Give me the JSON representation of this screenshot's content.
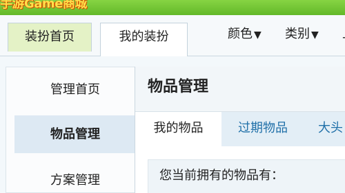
{
  "banner": {
    "title": "手游Game商城"
  },
  "tabs": [
    {
      "label": "装扮首页"
    },
    {
      "label": "我的装扮"
    }
  ],
  "filters": [
    {
      "label": "颜色",
      "icon": "caret-down-icon"
    },
    {
      "label": "类别",
      "icon": "caret-down-icon"
    },
    {
      "label": "上"
    }
  ],
  "sidebar": {
    "items": [
      {
        "label": "管理首页"
      },
      {
        "label": "物品管理"
      },
      {
        "label": "方案管理"
      }
    ]
  },
  "main": {
    "title": "物品管理",
    "subtabs": [
      {
        "label": "我的物品"
      },
      {
        "label": "过期物品"
      },
      {
        "label": "大头"
      }
    ],
    "content_text": "您当前拥有的物品有："
  },
  "colors": {
    "banner_green": "#74c636",
    "active_tab": "#e4f2c6",
    "link_blue": "#1f6fa8"
  }
}
